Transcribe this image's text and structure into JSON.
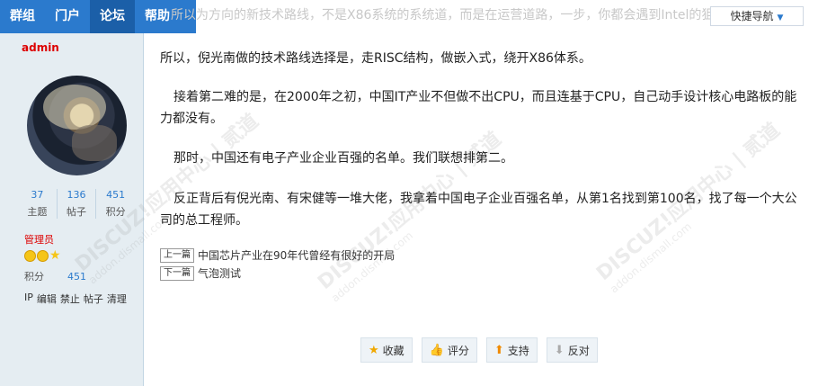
{
  "nav": {
    "items": [
      {
        "label": "群组"
      },
      {
        "label": "门户"
      },
      {
        "label": "论坛"
      },
      {
        "label": "帮助"
      }
    ],
    "active_index": 2,
    "quick_nav_label": "快捷导航"
  },
  "ghost_text": "所以为方向的新技术路线，不是X86系统的系统道，而是在运营道路，一步，你都会遇到Intel的狙击，我们打不起官司。",
  "sidebar": {
    "author": "admin",
    "stats": [
      {
        "value": "37",
        "label": "主题"
      },
      {
        "value": "136",
        "label": "帖子"
      },
      {
        "value": "451",
        "label": "积分"
      }
    ],
    "role": "管理员",
    "credits_label": "积分",
    "credits_value": "451",
    "mod_links": [
      "IP",
      "编辑",
      "禁止",
      "帖子",
      "清理"
    ]
  },
  "post": {
    "paragraphs": [
      "所以，倪光南做的技术路线选择是，走RISC结构，做嵌入式，绕开X86体系。",
      "接着第二难的是，在2000年之初，中国IT产业不但做不出CPU，而且连基于CPU，自己动手设计核心电路板的能力都没有。",
      "那时，中国还有电子产业企业百强的名单。我们联想排第二。",
      "反正背后有倪光南、有宋健等一堆大佬，我拿着中国电子企业百强名单，从第1名找到第100名，找了每一个大公司的总工程师。"
    ],
    "prev_tag": "上一篇",
    "prev_title": "中国芯片产业在90年代曾经有很好的开局",
    "next_tag": "下一篇",
    "next_title": "气泡测试"
  },
  "watermark": {
    "main": "DISCUZ!应用中心 | 贰道",
    "sub": "addon.dismall.com"
  },
  "actions": [
    {
      "label": "收藏",
      "icon": "star-icon"
    },
    {
      "label": "评分",
      "icon": "rate-icon"
    },
    {
      "label": "支持",
      "icon": "thumb-up-icon"
    },
    {
      "label": "反对",
      "icon": "thumb-down-icon"
    }
  ],
  "colors": {
    "nav_bg": "#2b7acd",
    "nav_active": "#1b5fa8",
    "author": "#dd0000",
    "link": "#2b7acd"
  }
}
